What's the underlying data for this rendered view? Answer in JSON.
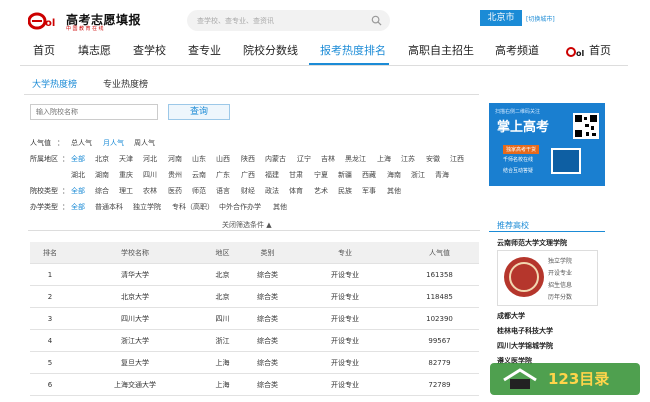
{
  "header": {
    "site_title": "高考志愿填报",
    "site_subtitle": "中国教育在线",
    "search_placeholder": "查学校、查专业、查资讯",
    "city": "北京市",
    "switch_city": "[切换城市]"
  },
  "nav": {
    "items": [
      "首页",
      "填志愿",
      "查学校",
      "查专业",
      "院校分数线",
      "报考热度排名",
      "高职自主招生",
      "高考频道",
      "首页"
    ],
    "active_index": 5
  },
  "subtabs": {
    "university": "大学热度榜",
    "major": "专业热度榜"
  },
  "filter": {
    "input_placeholder": "输入院校名称",
    "query_button": "查询",
    "popularity": {
      "label": "人气值",
      "options": [
        "总人气",
        "月人气",
        "周人气"
      ],
      "selected": 1
    },
    "region": {
      "label": "所属地区",
      "options_row1": [
        "全部",
        "北京",
        "天津",
        "河北",
        "河南",
        "山东",
        "山西",
        "陕西",
        "内蒙古",
        "辽宁",
        "吉林",
        "黑龙江",
        "上海",
        "江苏",
        "安徽",
        "江西"
      ],
      "options_row2": [
        "湖北",
        "湖南",
        "重庆",
        "四川",
        "贵州",
        "云南",
        "广东",
        "广西",
        "福建",
        "甘肃",
        "宁夏",
        "新疆",
        "西藏",
        "海南",
        "浙江",
        "青海"
      ],
      "selected": 0
    },
    "school_type": {
      "label": "院校类型",
      "options": [
        "全部",
        "综合",
        "理工",
        "农林",
        "医药",
        "师范",
        "语言",
        "财经",
        "政法",
        "体育",
        "艺术",
        "民族",
        "军事",
        "其他"
      ],
      "selected": 0
    },
    "school_level": {
      "label": "办学类型",
      "options": [
        "全部",
        "普通本科",
        "独立学院",
        "专科（高职）",
        "中外合作办学",
        "其他"
      ],
      "selected": 0
    },
    "close_filter": "关闭筛选条件 ▲"
  },
  "table": {
    "headers": [
      "排名",
      "学校名称",
      "地区",
      "类别",
      "专业",
      "人气值"
    ],
    "rows": [
      [
        "1",
        "清华大学",
        "北京",
        "综合类",
        "开设专业",
        "161358"
      ],
      [
        "2",
        "北京大学",
        "北京",
        "综合类",
        "开设专业",
        "118485"
      ],
      [
        "3",
        "四川大学",
        "四川",
        "综合类",
        "开设专业",
        "102390"
      ],
      [
        "4",
        "浙江大学",
        "浙江",
        "综合类",
        "开设专业",
        "99567"
      ],
      [
        "5",
        "复旦大学",
        "上海",
        "综合类",
        "开设专业",
        "82779"
      ],
      [
        "6",
        "上海交通大学",
        "上海",
        "综合类",
        "开设专业",
        "72789"
      ]
    ]
  },
  "ad": {
    "top": "扫描右侧二维码关注",
    "title": "掌上高考",
    "line1": "独家高考干货",
    "line2": "千师名校在线",
    "line3": "结合互动答疑"
  },
  "recommend": {
    "title": "推荐高校",
    "featured": "云南师范大学文理学院",
    "links": [
      "独立学院",
      "开设专业",
      "招生信息",
      "历年分数"
    ],
    "schools": [
      "成都大学",
      "桂林电子科技大学",
      "四川大学锦城学院",
      "遵义医学院"
    ]
  },
  "watermark": "123目录",
  "colors": {
    "accent": "#1b8bd6",
    "logo_red": "#c00000"
  }
}
